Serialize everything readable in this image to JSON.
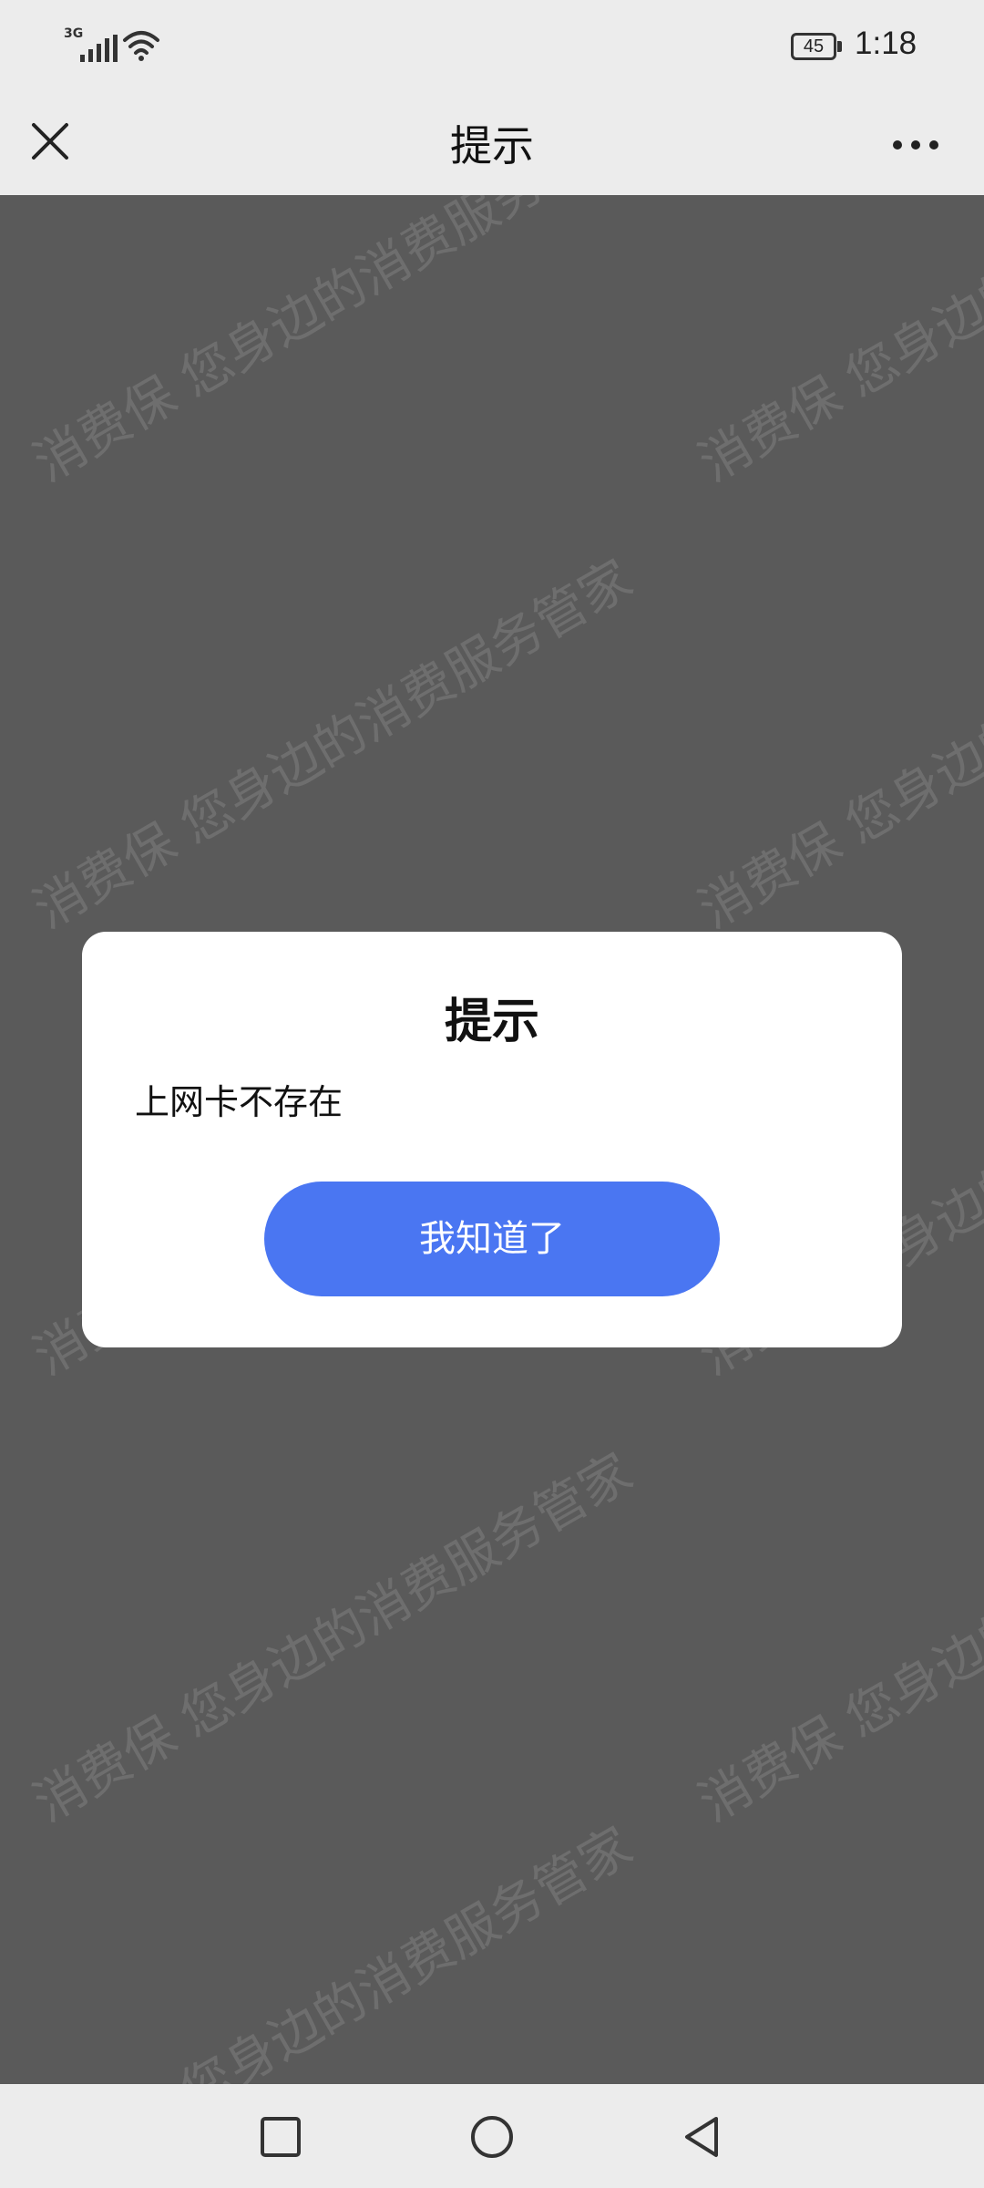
{
  "status_bar": {
    "network": "3G",
    "battery": "45",
    "time": "1:18"
  },
  "title_bar": {
    "title": "提示",
    "close_icon": "close-icon",
    "more_icon": "more-icon"
  },
  "watermark": {
    "text": "消费保 您身边的消费服务管家"
  },
  "dialog": {
    "title": "提示",
    "message": "上网卡不存在",
    "button_label": "我知道了",
    "button_color": "#4a76f2"
  },
  "nav_bar": {
    "icons": [
      "recent-apps-icon",
      "home-icon",
      "back-icon"
    ]
  },
  "colors": {
    "overlay": "#5a5a5a",
    "bars": "#ececec",
    "dialog": "#ffffff"
  }
}
